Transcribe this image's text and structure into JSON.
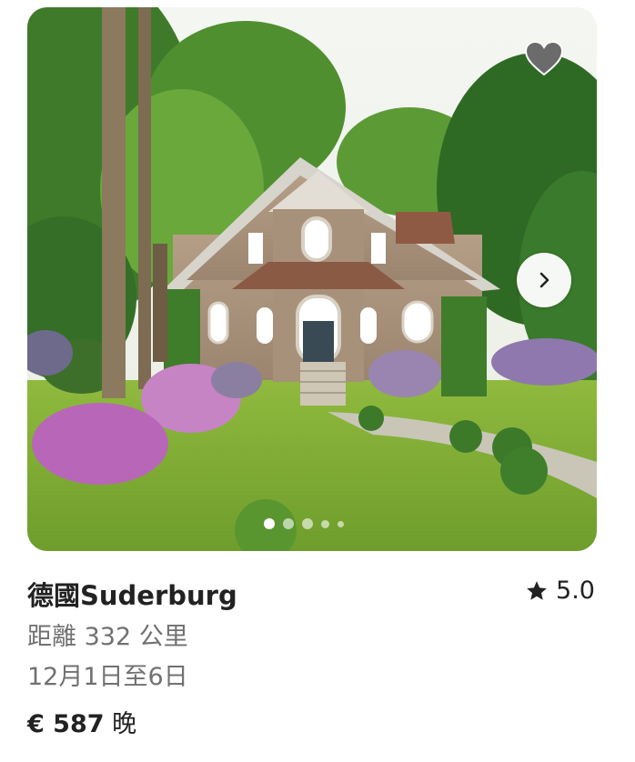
{
  "listing": {
    "title": "德國Suderburg",
    "rating": "5.0",
    "distance": "距離 332 公里",
    "dates": "12月1日至6日",
    "price": "€ 587",
    "price_unit": "晚"
  },
  "carousel": {
    "image_count": 5,
    "active_index": 0
  },
  "icons": {
    "wishlist": "heart-icon",
    "next": "chevron-right-icon",
    "rating": "star-icon"
  },
  "colors": {
    "text_primary": "#222222",
    "text_secondary": "#717171",
    "heart_fill": "#6b6b6b"
  }
}
